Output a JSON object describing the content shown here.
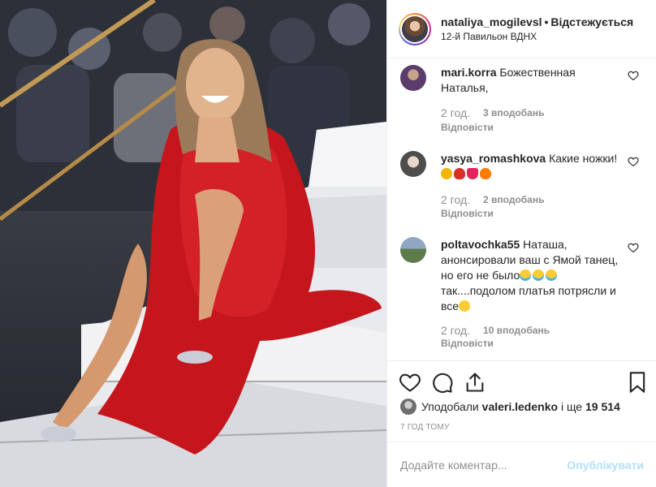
{
  "header": {
    "username": "nataliya_mogilevsl",
    "separator": "•",
    "follow_status": "Відстежується",
    "location": "12-й Павильон ВДНХ"
  },
  "comments": [
    {
      "user": "mari.korra",
      "text": "Божественная Наталья,",
      "time": "2 год.",
      "likes": "3 вподобань",
      "reply": "Відповісти"
    },
    {
      "user": "yasya_romashkova",
      "text": "Какие ножки!",
      "emojis": [
        "clapping-hands",
        "rose",
        "red-heart",
        "fire"
      ],
      "time": "2 год.",
      "likes": "2 вподобань",
      "reply": "Відповісти"
    },
    {
      "user": "poltavochka55",
      "text_before": "Наташа, анонсировали ваш с Ямой танец, но его не было",
      "text_after": "так....подолом платья потрясли и все",
      "emojis_mid": [
        "loudly-crying-face",
        "loudly-crying-face",
        "loudly-crying-face"
      ],
      "emojis_end": [
        "astonished-face"
      ],
      "time": "2 год.",
      "likes": "10 вподобань",
      "reply": "Відповісти"
    }
  ],
  "liked_by": {
    "prefix": "Уподобали",
    "user": "valeri.ledenko",
    "suffix": "і ще",
    "count": "19 514"
  },
  "timestamp": "7 ГОД ТОМУ",
  "comment_box": {
    "placeholder": "Додайте коментар...",
    "publish_label": "Опублікувати"
  },
  "icons": {
    "like": "heart-icon",
    "comment": "speech-bubble-icon",
    "share": "share-icon",
    "save": "bookmark-icon"
  },
  "colors": {
    "text": "#262626",
    "muted": "#8e8e8e",
    "publish_disabled": "#b2dffc",
    "dress": "#c4161c"
  }
}
